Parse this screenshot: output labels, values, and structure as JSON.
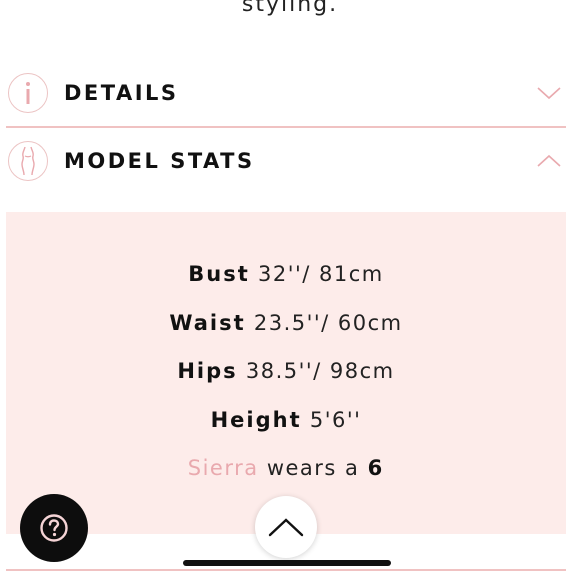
{
  "top_text": "styling.",
  "sections": {
    "details": {
      "title": "DETAILS",
      "icon": "info-icon",
      "chevron": "chevron-down-icon",
      "expanded": false
    },
    "model_stats": {
      "title": "MODEL STATS",
      "icon": "body-silhouette-icon",
      "chevron": "chevron-up-icon",
      "expanded": true
    }
  },
  "stats": {
    "bust": {
      "label": "Bust",
      "value": "32''/ 81cm"
    },
    "waist": {
      "label": "Waist",
      "value": "23.5''/ 60cm"
    },
    "hips": {
      "label": "Hips",
      "value": "38.5''/ 98cm"
    },
    "height": {
      "label": "Height",
      "value": "5'6''"
    },
    "model_line": {
      "name": "Sierra",
      "text": "wears a",
      "size": "6"
    }
  },
  "buttons": {
    "help_icon": "question-icon",
    "scroll_top_icon": "chevron-up-icon"
  },
  "colors": {
    "accent_pink": "#e9a9ae",
    "panel_bg": "#fdecea",
    "divider": "#f0c2c2",
    "help_bg": "#0d0d0d"
  }
}
